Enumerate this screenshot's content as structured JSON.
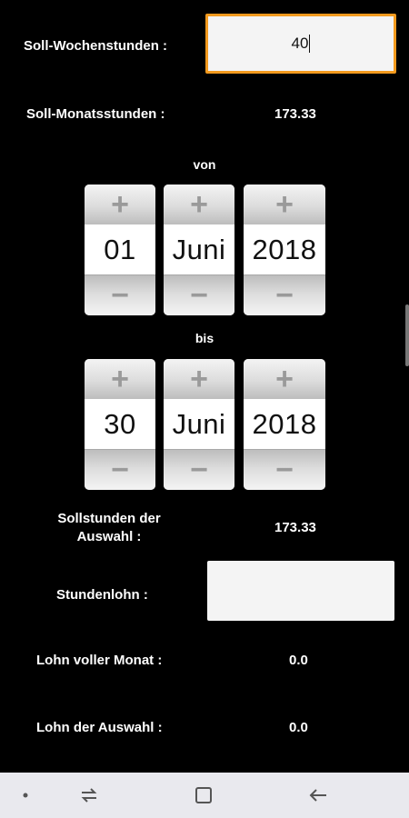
{
  "weekly_hours": {
    "label": "Soll-Wochenstunden :",
    "value": "40"
  },
  "monthly_hours": {
    "label": "Soll-Monatsstunden :",
    "value": "173.33"
  },
  "from": {
    "label": "von",
    "day": "01",
    "month": "Juni",
    "year": "2018",
    "plus": "+",
    "minus": "−"
  },
  "to": {
    "label": "bis",
    "day": "30",
    "month": "Juni",
    "year": "2018",
    "plus": "+",
    "minus": "−"
  },
  "selection_hours": {
    "label_line1": "Sollstunden der",
    "label_line2": "Auswahl :",
    "value": "173.33"
  },
  "hourly_wage": {
    "label": "Stundenlohn :",
    "value": ""
  },
  "wage_full_month": {
    "label": "Lohn voller Monat :",
    "value": "0.0"
  },
  "wage_selection": {
    "label": "Lohn der Auswahl :",
    "value": "0.0"
  },
  "navbar": {
    "icons": [
      "dot-icon",
      "recent-apps-icon",
      "home-icon",
      "back-icon"
    ]
  },
  "colors": {
    "focus_border": "#f39a1e",
    "background": "#000000",
    "navbar": "#e9e9ee"
  }
}
